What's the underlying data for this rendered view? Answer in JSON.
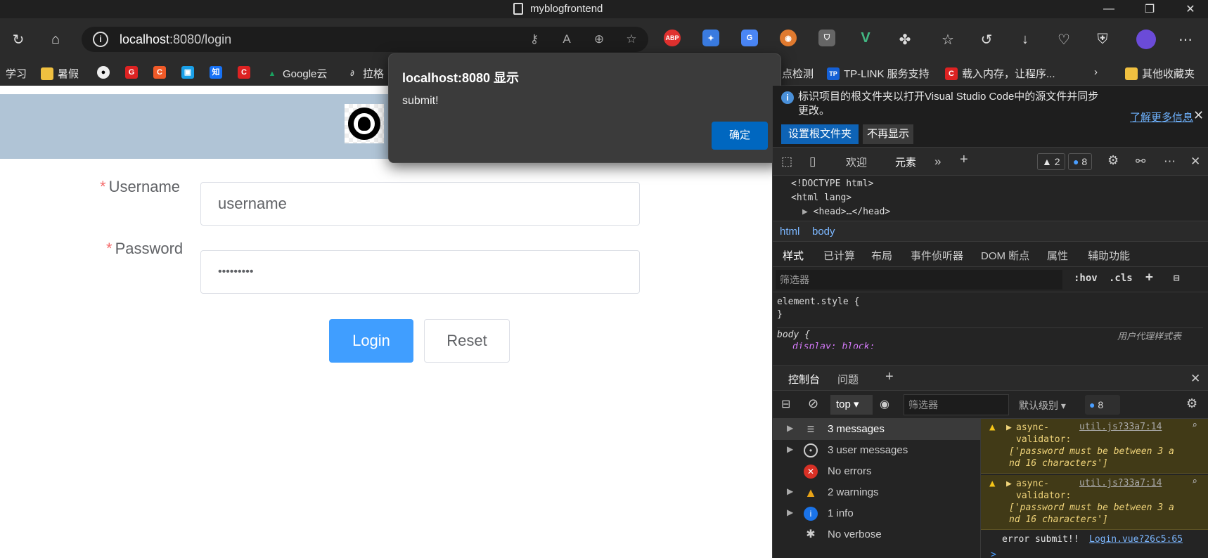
{
  "window": {
    "title": "myblogfrontend"
  },
  "toolbar": {
    "url_host": "localhost",
    "url_rest": ":8080/login"
  },
  "extensions": [
    {
      "name": "abp",
      "label": "ABP",
      "color": "#e0312f"
    },
    {
      "name": "ext-blue",
      "label": "✦",
      "color": "#3a7be0"
    },
    {
      "name": "translate",
      "label": "G",
      "color": "#4a86f5"
    },
    {
      "name": "ext-fox",
      "label": "◉",
      "color": "#e07a2f"
    },
    {
      "name": "shield",
      "label": "⛉",
      "color": "#555"
    },
    {
      "name": "vue",
      "label": "V",
      "color": "#2b2b2b"
    }
  ],
  "bookmarks": [
    {
      "label": "学习",
      "icon": "",
      "color": ""
    },
    {
      "label": "暑假",
      "icon": "▬",
      "color": "#f0c040"
    },
    {
      "label": "",
      "icon": "●",
      "color": "#222"
    },
    {
      "label": "",
      "icon": "G",
      "color": "#d22"
    },
    {
      "label": "",
      "icon": "C",
      "color": "#f05a28"
    },
    {
      "label": "",
      "icon": "▣",
      "color": "#1aa0e8"
    },
    {
      "label": "",
      "icon": "知",
      "color": "#1772f6"
    },
    {
      "label": "",
      "icon": "C",
      "color": "#d22"
    },
    {
      "label": "Google云",
      "icon": "▲",
      "color": "#1aa260"
    },
    {
      "label": "拉格",
      "icon": "∂",
      "color": "#555"
    }
  ],
  "bookmarks_right": [
    {
      "label": "点检测",
      "icon": "",
      "color": ""
    },
    {
      "label": "TP-LINK 服务支持",
      "icon": "TP",
      "color": "#1560d6"
    },
    {
      "label": "载入内存，让程序...",
      "icon": "C",
      "color": "#d22"
    }
  ],
  "other_favorites": "其他收藏夹",
  "page": {
    "username_label": "Username",
    "username_value": "username",
    "password_label": "Password",
    "password_value": "•••••••••",
    "required_mark": "*",
    "login_button": "Login",
    "reset_button": "Reset"
  },
  "dialog": {
    "title": "localhost:8080 显示",
    "message": "submit!",
    "ok": "确定"
  },
  "devtools": {
    "notice": {
      "text": "标识项目的根文件夹以打开Visual Studio Code中的源文件并同步更改。",
      "learn_more": "了解更多信息",
      "set_root": "设置根文件夹",
      "dont_show": "不再显示"
    },
    "tabs": {
      "welcome": "欢迎",
      "elements": "元素"
    },
    "warnings_count": "2",
    "messages_count": "8",
    "dom": {
      "line1": "<!DOCTYPE html>",
      "line2": "<html lang>",
      "line3": "<head>…</head>"
    },
    "crumbs": [
      "html",
      "body"
    ],
    "style_tabs": [
      "样式",
      "已计算",
      "布局",
      "事件侦听器",
      "DOM 断点",
      "属性",
      "辅助功能"
    ],
    "filter_placeholder": "筛选器",
    "hov": ":hov",
    "cls": ".cls",
    "styles": {
      "element_style": "element.style {",
      "close_brace": "}",
      "body_rule": "body {",
      "ua_label": "用户代理样式表",
      "display_line": "display: block;"
    },
    "drawer_tabs": {
      "console": "控制台",
      "issues": "问题"
    },
    "console": {
      "context": "top",
      "filter_placeholder": "筛选器",
      "level": "默认级别",
      "msg_badge": "8"
    },
    "sidebar": [
      {
        "label": "3 messages",
        "icon": "list-icon",
        "glyph": "☰",
        "color": "#3a3a3a",
        "arrow": true,
        "selected": true
      },
      {
        "label": "3 user messages",
        "icon": "user-icon",
        "glyph": "◉",
        "color": "#555",
        "arrow": true,
        "selected": false
      },
      {
        "label": "No errors",
        "icon": "error-icon",
        "glyph": "✕",
        "color": "#d93025",
        "arrow": false,
        "selected": false
      },
      {
        "label": "2 warnings",
        "icon": "warning-icon",
        "glyph": "!",
        "color": "#e8a317",
        "arrow": true,
        "selected": false
      },
      {
        "label": "1 info",
        "icon": "info-icon",
        "glyph": "i",
        "color": "#1a73e8",
        "arrow": true,
        "selected": false
      },
      {
        "label": "No verbose",
        "icon": "bug-icon",
        "glyph": "✱",
        "color": "#242424",
        "arrow": false,
        "selected": false
      }
    ],
    "logs": [
      {
        "title": "async-\nvalidator:",
        "source": "util.js?33a7:14",
        "detail": "['password must be between 3 a\nnd 16 characters']"
      },
      {
        "title": "async-\nvalidator:",
        "source": "util.js?33a7:14",
        "detail": "['password must be between 3 a\nnd 16 characters']"
      }
    ],
    "log_line": {
      "text": "error submit!!",
      "source": "Login.vue?26c5:65"
    },
    "prompt": ">"
  }
}
